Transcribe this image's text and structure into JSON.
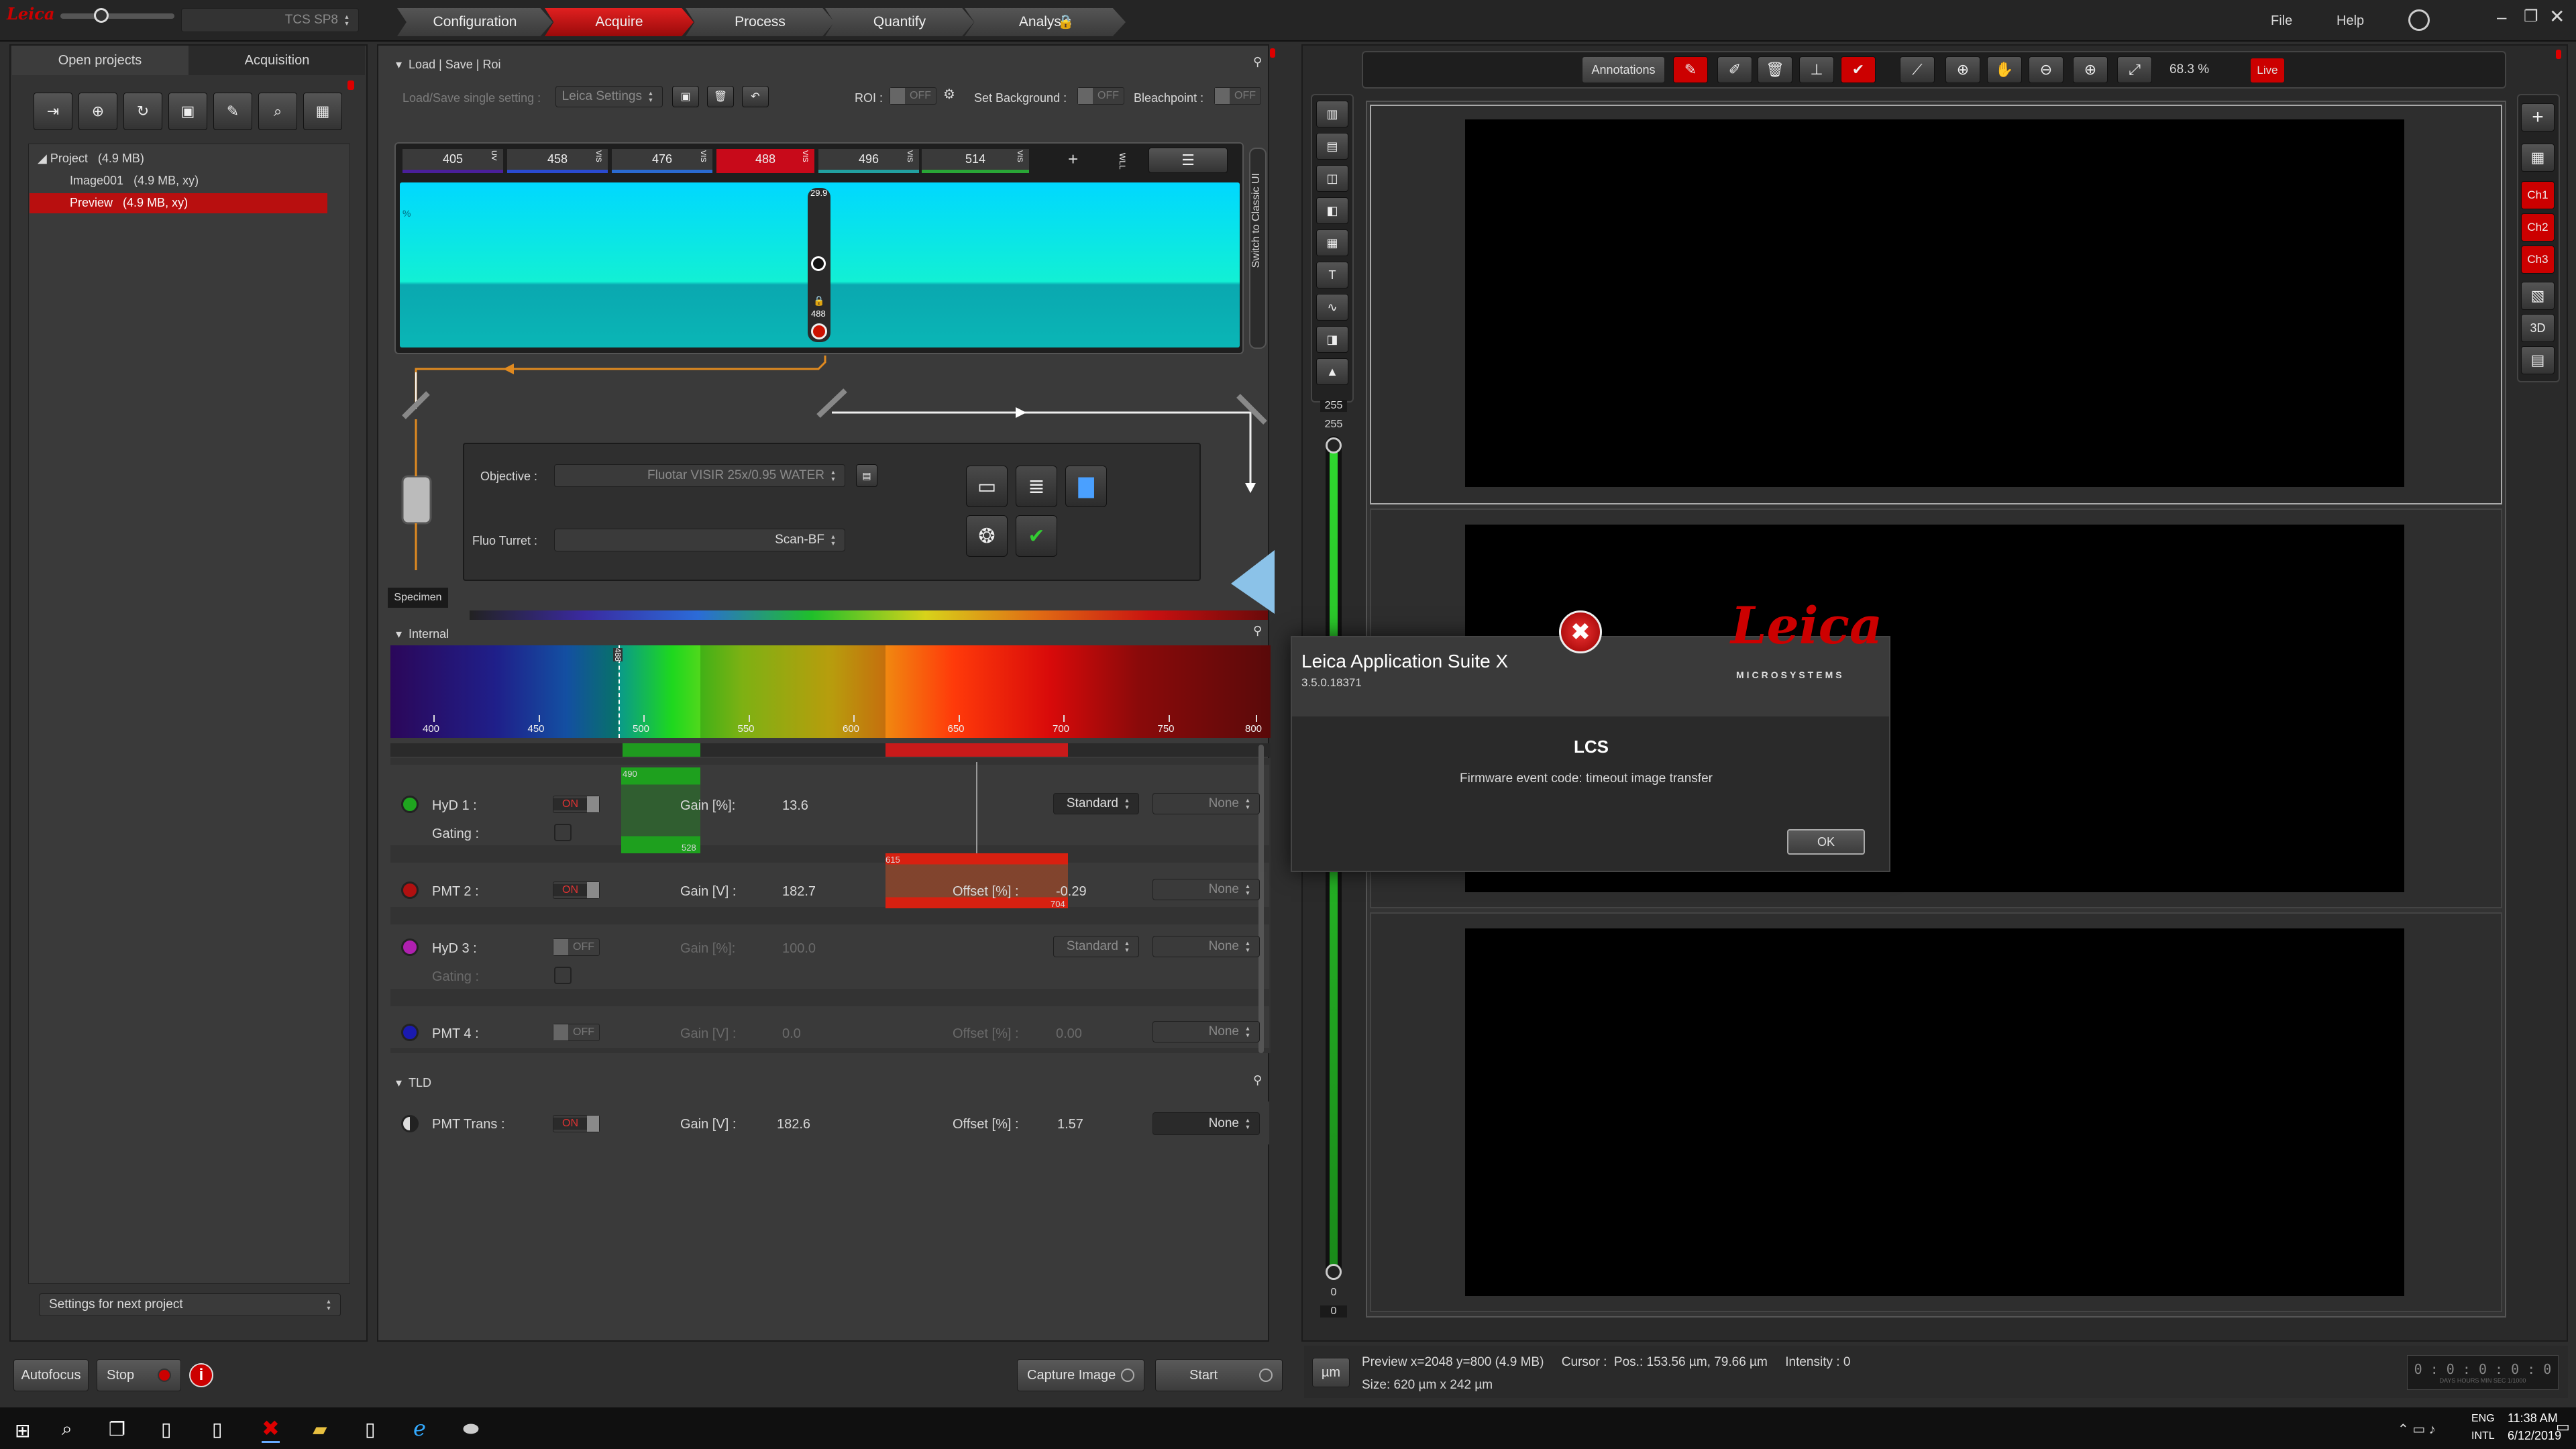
{
  "titlebar": {
    "device": "TCS SP8",
    "tabs": [
      "Configuration",
      "Acquire",
      "Process",
      "Quantify",
      "Analysis"
    ],
    "active_tab": 1,
    "menu": [
      "File",
      "Help"
    ]
  },
  "left": {
    "tabs": [
      "Open projects",
      "Acquisition"
    ],
    "tree": [
      {
        "name": "Project",
        "size": "(4.9 MB)"
      },
      {
        "name": "Image001",
        "size": "(4.9 MB, xy)"
      },
      {
        "name": "Preview",
        "size": "(4.9 MB, xy)"
      }
    ],
    "settings": "Settings for next project"
  },
  "load": {
    "title": "Load | Save | Roi",
    "label": "Load/Save single setting :",
    "value": "Leica Settings",
    "roi": "ROI :",
    "roi_state": "OFF",
    "bg": "Set Background :",
    "bg_state": "OFF",
    "bleach": "Bleachpoint :",
    "bleach_state": "OFF"
  },
  "lasers": {
    "lines": [
      "405",
      "458",
      "476",
      "488",
      "496",
      "514"
    ],
    "tag": "VIS",
    "uv": "UV",
    "wll": "WLL",
    "slider_top": "29.9",
    "slider_bottom": "488",
    "side": "Switch to Classic UI",
    "pct": "%"
  },
  "optics": {
    "objective_label": "Objective :",
    "objective": "Fluotar VISIR   25x/0.95 WATER",
    "turret_label": "Fluo Turret :",
    "turret": "Scan-BF",
    "specimen": "Specimen"
  },
  "internal": {
    "title": "Internal",
    "ticks": [
      "400",
      "450",
      "500",
      "550",
      "600",
      "650",
      "700",
      "750",
      "800"
    ],
    "marker": "488"
  },
  "detectors": [
    {
      "name": "HyD 1 :",
      "state": "ON",
      "gain_label": "Gain [%]:",
      "gain": "13.6",
      "mode": "Standard",
      "lut": "None",
      "gating": "Gating :",
      "range": [
        "490",
        "528"
      ],
      "color": "#1fa51f"
    },
    {
      "name": "PMT 2 :",
      "state": "ON",
      "gain_label": "Gain [V] :",
      "gain": "182.7",
      "offset_label": "Offset [%] :",
      "offset": "-0.29",
      "lut": "None",
      "range": [
        "615",
        "704"
      ],
      "color": "#b01010"
    },
    {
      "name": "HyD 3 :",
      "state": "OFF",
      "gain_label": "Gain [%]:",
      "gain": "100.0",
      "mode": "Standard",
      "lut": "None",
      "gating": "Gating :",
      "color": "#b020b0"
    },
    {
      "name": "PMT 4 :",
      "state": "OFF",
      "gain_label": "Gain [V] :",
      "gain": "0.0",
      "offset_label": "Offset [%] :",
      "offset": "0.00",
      "lut": "None",
      "color": "#1a1ab0"
    }
  ],
  "tld": {
    "title": "TLD",
    "name": "PMT Trans :",
    "state": "ON",
    "gain_label": "Gain [V] :",
    "gain": "182.6",
    "offset_label": "Offset [%] :",
    "offset": "1.57",
    "lut": "None"
  },
  "bottom": {
    "autofocus": "Autofocus",
    "stop": "Stop",
    "capture": "Capture Image",
    "start": "Start"
  },
  "viewer": {
    "annotations": "Annotations",
    "zoom": "68.3 %",
    "live": "Live",
    "channels": [
      "Ch1",
      "Ch2",
      "Ch3"
    ],
    "view3d": "3D",
    "intensity_top": "255",
    "intensity_top2": "255",
    "intensity_bottom": "0",
    "intensity_bottom2": "0"
  },
  "status": {
    "unit": "µm",
    "line1": "Preview x=2048 y=800 (4.9 MB)     Cursor :  Pos.: 153.56 µm, 79.66 µm     Intensity : 0",
    "line2": "Size: 620 µm x 242 µm",
    "timer": "0 : 0 : 0 : 0 : 0",
    "timer_units": "DAYS  HOURS  MIN  SEC  1/1000"
  },
  "dialog": {
    "app": "Leica Application Suite X",
    "version": "3.5.0.18371",
    "brand": "Leica",
    "brand_sub": "MICROSYSTEMS",
    "heading": "LCS",
    "message": "Firmware event code: timeout image transfer",
    "ok": "OK"
  },
  "taskbar": {
    "time": "11:38 AM",
    "date": "6/12/2019",
    "lang": "ENG",
    "lang2": "INTL"
  }
}
